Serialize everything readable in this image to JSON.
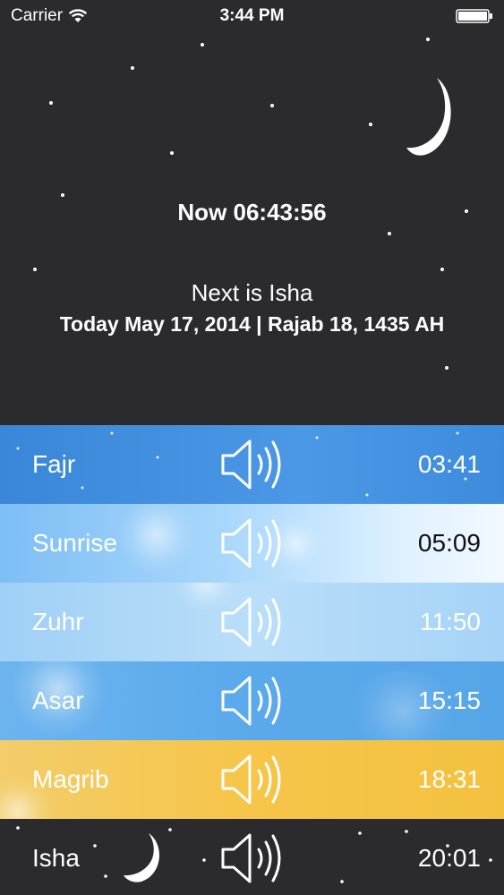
{
  "status_bar": {
    "carrier": "Carrier",
    "time": "3:44 PM"
  },
  "header": {
    "now_label": "Now 06:43:56",
    "next_label": "Next is Isha",
    "date_label": "Today May 17, 2014 | Rajab 18, 1435 AH"
  },
  "prayers": [
    {
      "name": "Fajr",
      "time": "03:41"
    },
    {
      "name": "Sunrise",
      "time": "05:09"
    },
    {
      "name": "Zuhr",
      "time": "11:50"
    },
    {
      "name": "Asar",
      "time": "15:15"
    },
    {
      "name": "Magrib",
      "time": "18:31"
    },
    {
      "name": "Isha",
      "time": "20:01"
    }
  ],
  "icons": {
    "wifi": "wifi-icon",
    "battery": "battery-icon",
    "moon": "crescent-moon-icon",
    "speaker": "speaker-icon"
  },
  "colors": {
    "night": "#2b2a2c",
    "fajr": "#3a86d8",
    "sunrise": "#a9d7fb",
    "zuhr": "#b9def9",
    "asar": "#5aa9eb",
    "magrib": "#f6c549"
  }
}
